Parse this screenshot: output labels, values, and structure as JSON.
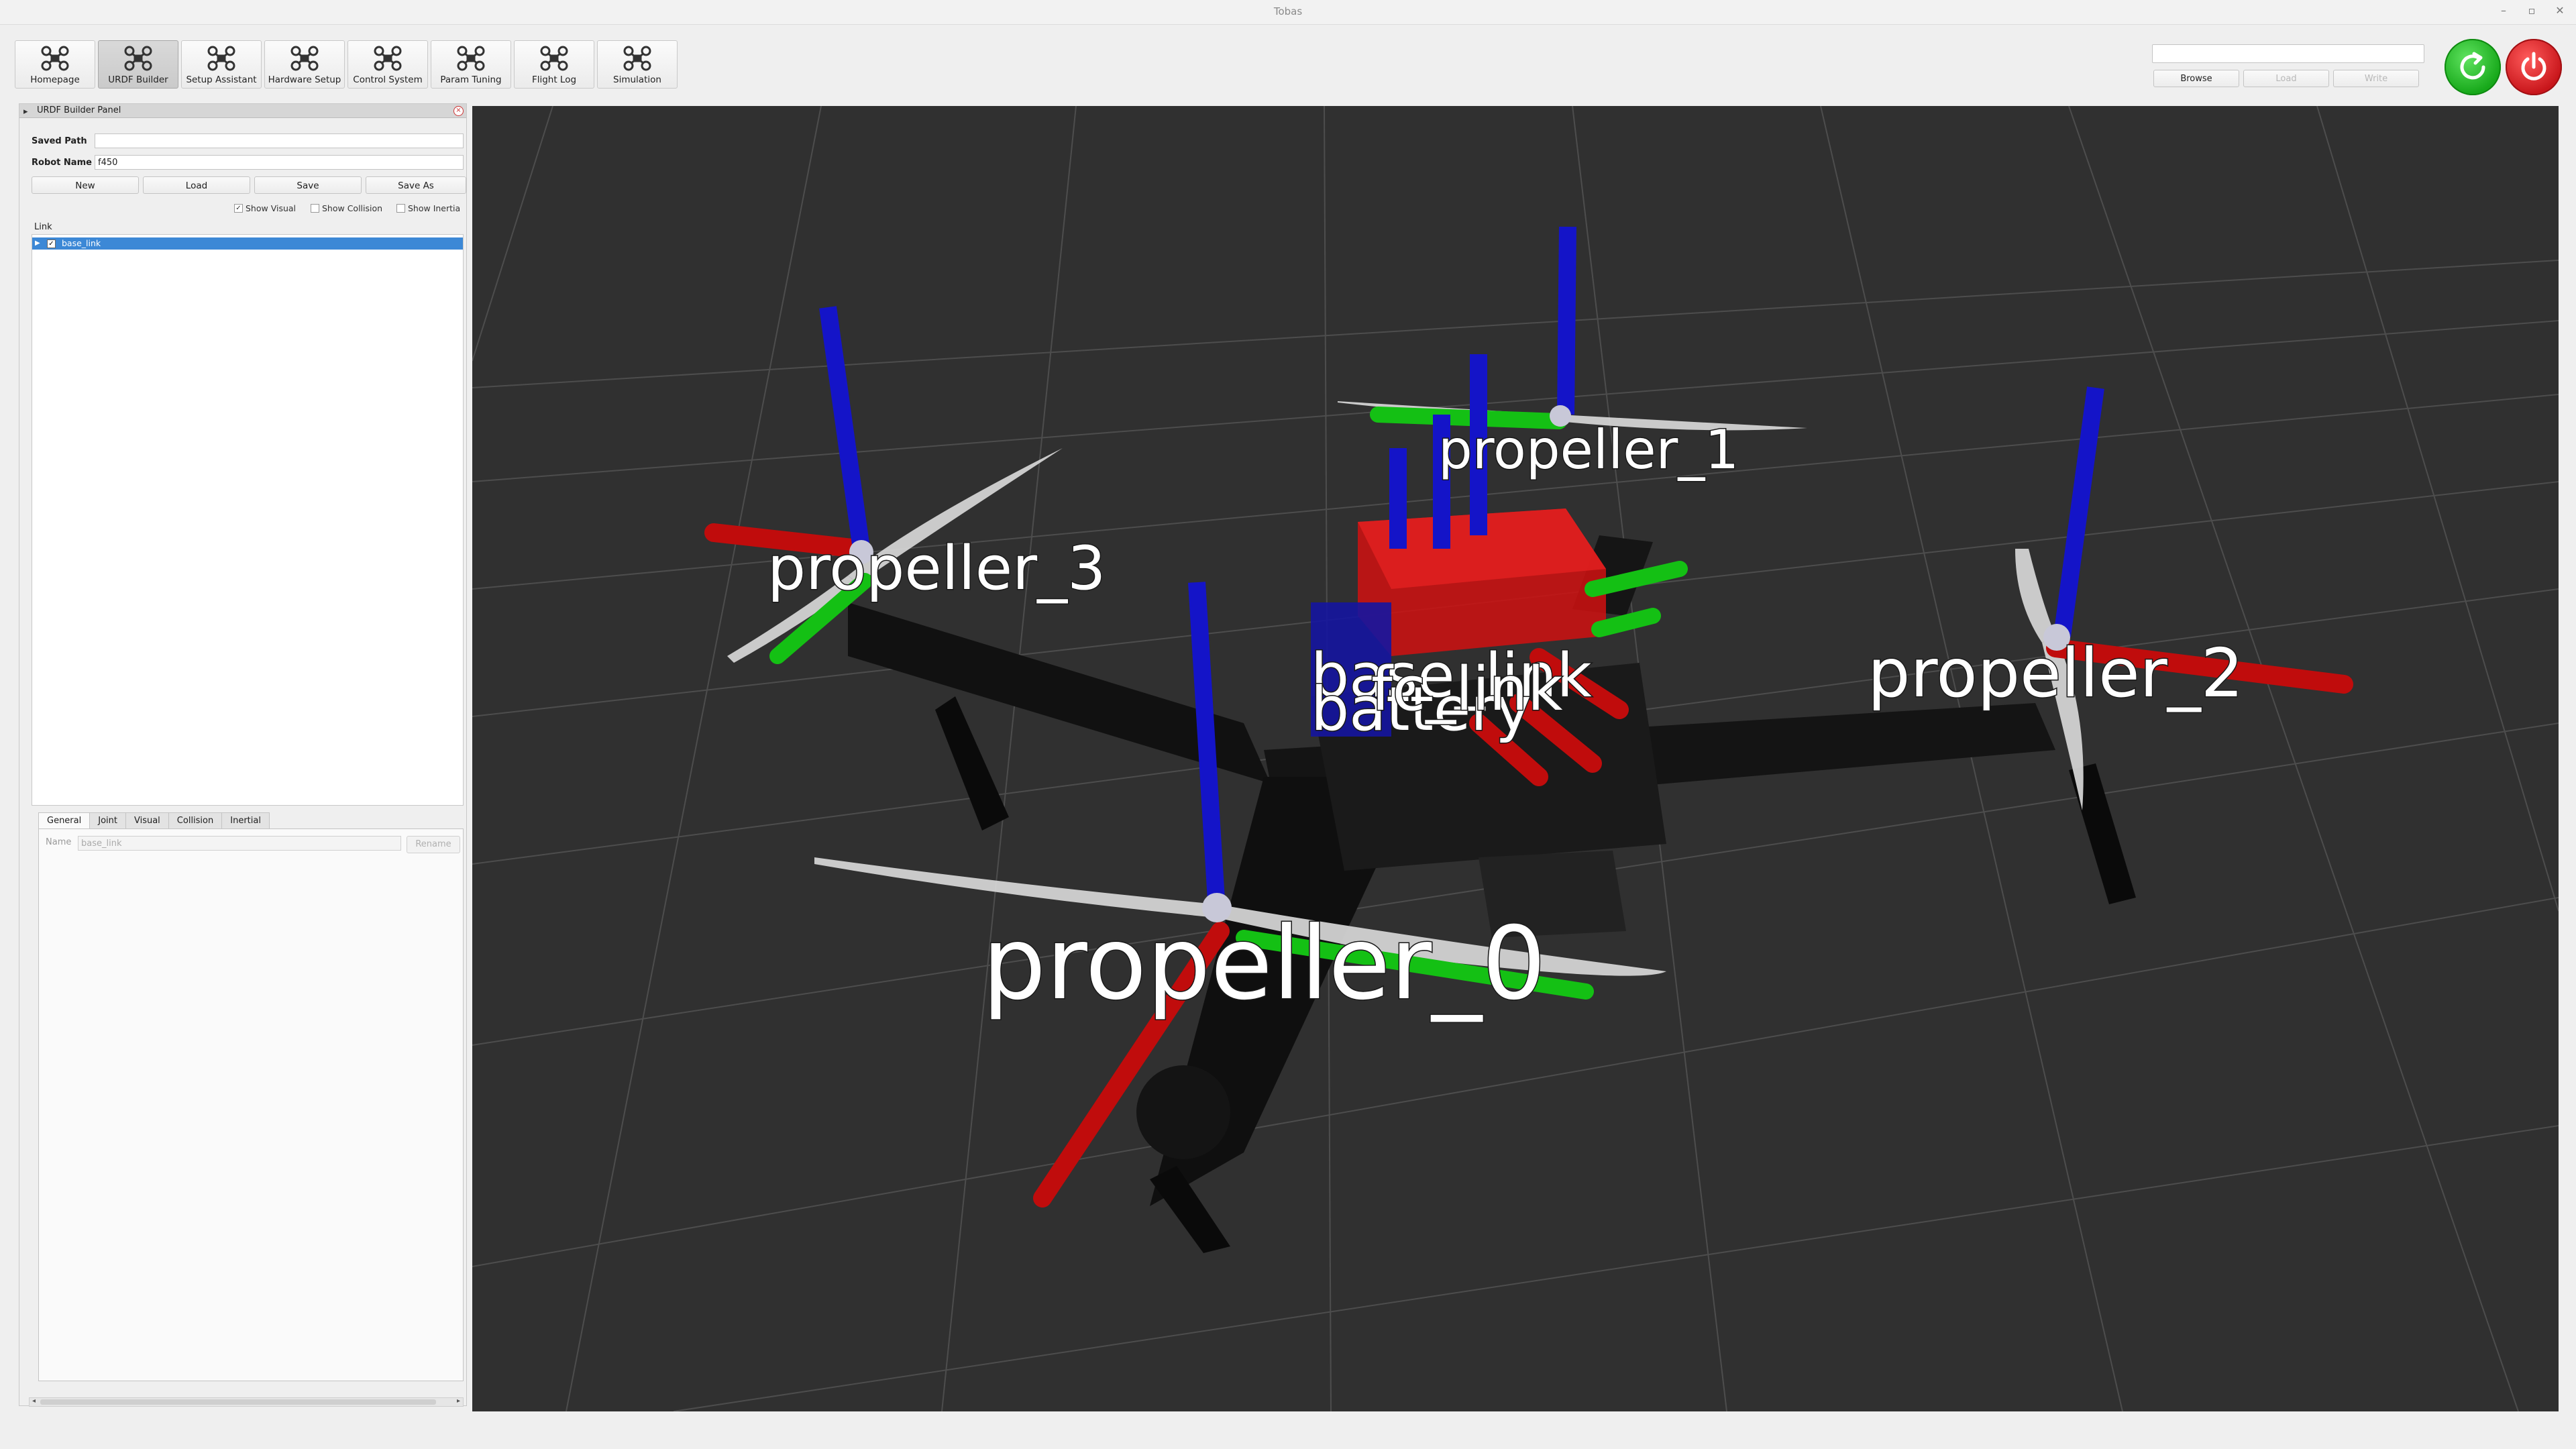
{
  "window": {
    "title": "Tobas"
  },
  "toolbar": {
    "items": [
      {
        "label": "Homepage"
      },
      {
        "label": "URDF Builder"
      },
      {
        "label": "Setup Assistant"
      },
      {
        "label": "Hardware Setup"
      },
      {
        "label": "Control System"
      },
      {
        "label": "Param Tuning"
      },
      {
        "label": "Flight Log"
      },
      {
        "label": "Simulation"
      }
    ],
    "active": "URDF Builder"
  },
  "top_right": {
    "path_value": "",
    "browse_label": "Browse",
    "load_label": "Load",
    "write_label": "Write"
  },
  "panel": {
    "title": "URDF Builder Panel",
    "saved_path_label": "Saved Path",
    "saved_path_value": "",
    "robot_name_label": "Robot Name",
    "robot_name_value": "f450",
    "new_label": "New",
    "load_label": "Load",
    "save_label": "Save",
    "save_as_label": "Save As",
    "show_visual_label": "Show Visual",
    "show_collision_label": "Show Collision",
    "show_inertia_label": "Show Inertia",
    "show_visual_checked": true,
    "show_collision_checked": false,
    "show_inertia_checked": false,
    "tree_header": "Link",
    "tree_items": [
      {
        "name": "base_link",
        "checked": true,
        "selected": true
      }
    ],
    "tabs": [
      "General",
      "Joint",
      "Visual",
      "Collision",
      "Inertial"
    ],
    "active_tab": "General",
    "name_label": "Name",
    "name_placeholder": "base_link",
    "rename_label": "Rename"
  },
  "viewport": {
    "labels": [
      "propeller_0",
      "propeller_1",
      "propeller_2",
      "propeller_3",
      "base_link",
      "battery",
      "fc_link"
    ],
    "background_color": "#303030",
    "axis_colors": {
      "x": "#d01010",
      "y": "#18c018",
      "z": "#1818d0"
    }
  },
  "icons": {
    "toolbar": "drone-icon",
    "refresh": "refresh-icon",
    "power": "power-icon"
  }
}
